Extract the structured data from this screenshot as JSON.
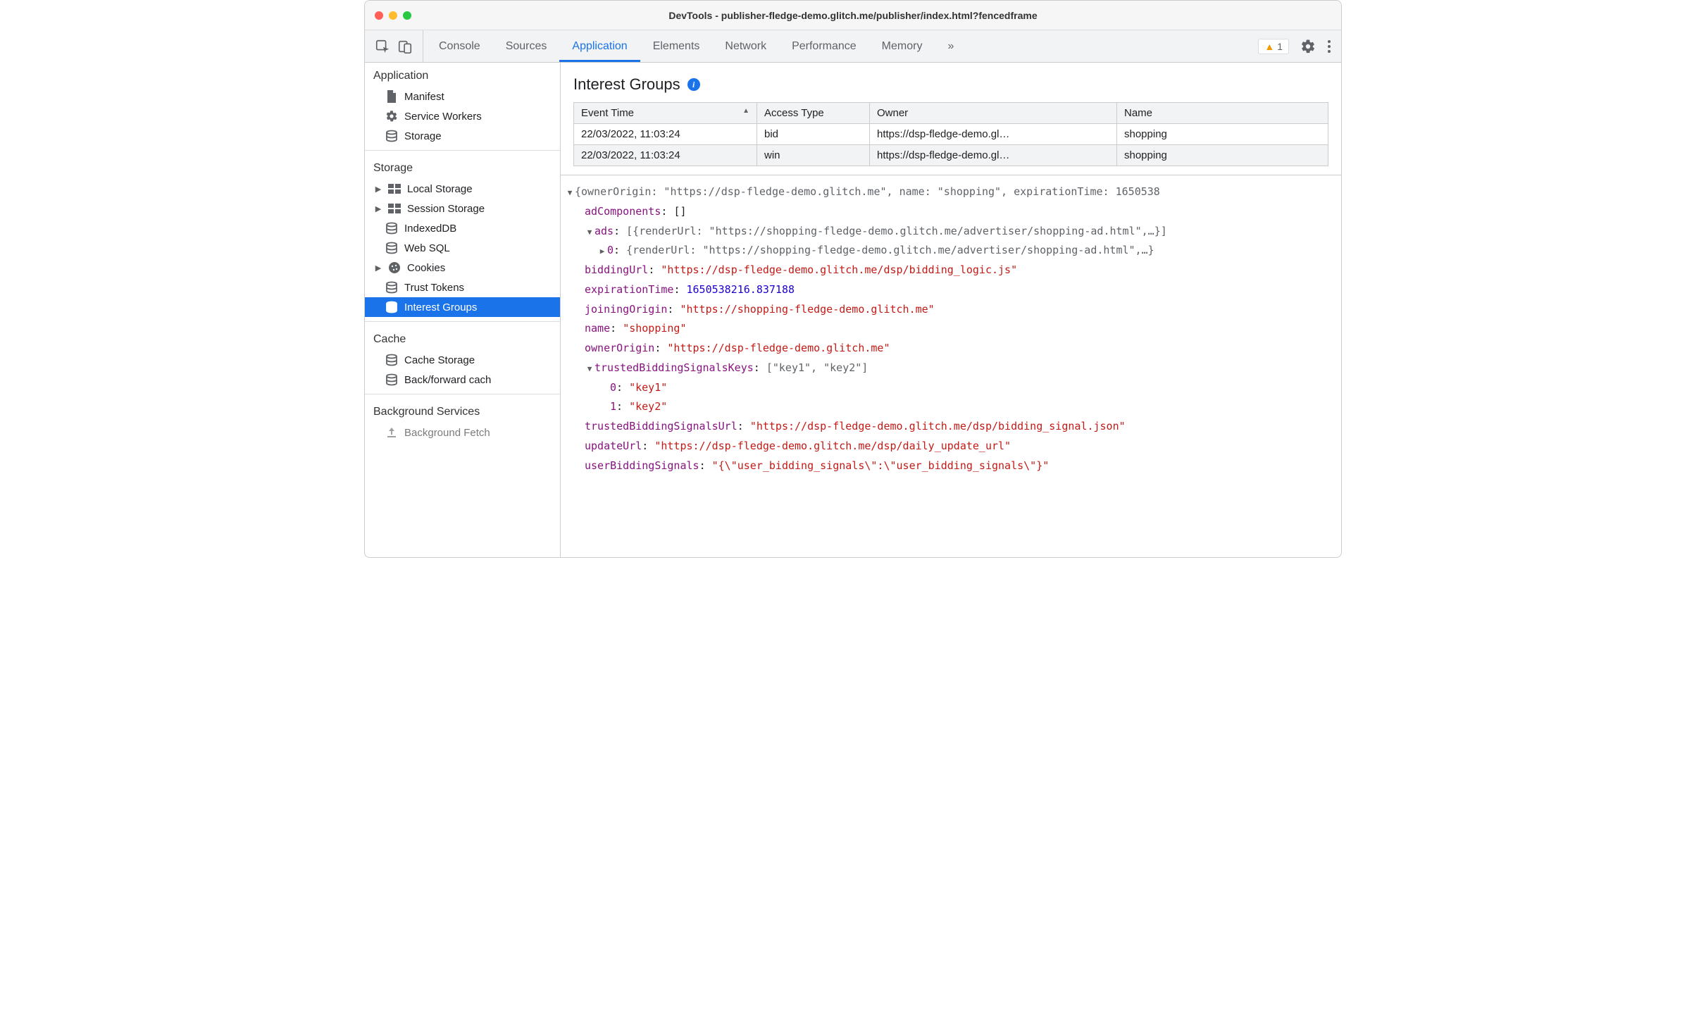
{
  "window": {
    "title": "DevTools - publisher-fledge-demo.glitch.me/publisher/index.html?fencedframe"
  },
  "toolbar": {
    "tabs": [
      "Console",
      "Sources",
      "Application",
      "Elements",
      "Network",
      "Performance",
      "Memory"
    ],
    "active_tab_index": 2,
    "more_label": "»",
    "warning_count": "1"
  },
  "sidebar": {
    "section_application": "Application",
    "app_items": [
      "Manifest",
      "Service Workers",
      "Storage"
    ],
    "section_storage": "Storage",
    "storage_items": [
      "Local Storage",
      "Session Storage",
      "IndexedDB",
      "Web SQL",
      "Cookies",
      "Trust Tokens",
      "Interest Groups"
    ],
    "section_cache": "Cache",
    "cache_items": [
      "Cache Storage",
      "Back/forward cach"
    ],
    "section_bg": "Background Services",
    "bg_items": [
      "Background Fetch"
    ]
  },
  "panel": {
    "title": "Interest Groups"
  },
  "table": {
    "columns": [
      "Event Time",
      "Access Type",
      "Owner",
      "Name"
    ],
    "sorted_col": 0,
    "rows": [
      {
        "time": "22/03/2022, 11:03:24",
        "type": "bid",
        "owner": "https://dsp-fledge-demo.gl…",
        "name": "shopping"
      },
      {
        "time": "22/03/2022, 11:03:24",
        "type": "win",
        "owner": "https://dsp-fledge-demo.gl…",
        "name": "shopping"
      }
    ]
  },
  "detail": {
    "header_preview": "{ownerOrigin: \"https://dsp-fledge-demo.glitch.me\", name: \"shopping\", expirationTime: 1650538",
    "adComponents_key": "adComponents",
    "adComponents_val": "[]",
    "ads_key": "ads",
    "ads_preview": "[{renderUrl: \"https://shopping-fledge-demo.glitch.me/advertiser/shopping-ad.html\",…}]",
    "ads0_key": "0",
    "ads0_preview": "{renderUrl: \"https://shopping-fledge-demo.glitch.me/advertiser/shopping-ad.html\",…}",
    "biddingUrl_key": "biddingUrl",
    "biddingUrl_val": "\"https://dsp-fledge-demo.glitch.me/dsp/bidding_logic.js\"",
    "expirationTime_key": "expirationTime",
    "expirationTime_val": "1650538216.837188",
    "joiningOrigin_key": "joiningOrigin",
    "joiningOrigin_val": "\"https://shopping-fledge-demo.glitch.me\"",
    "name_key": "name",
    "name_val": "\"shopping\"",
    "ownerOrigin_key": "ownerOrigin",
    "ownerOrigin_val": "\"https://dsp-fledge-demo.glitch.me\"",
    "tbsk_key": "trustedBiddingSignalsKeys",
    "tbsk_preview": "[\"key1\", \"key2\"]",
    "tbsk0_key": "0",
    "tbsk0_val": "\"key1\"",
    "tbsk1_key": "1",
    "tbsk1_val": "\"key2\"",
    "tbsu_key": "trustedBiddingSignalsUrl",
    "tbsu_val": "\"https://dsp-fledge-demo.glitch.me/dsp/bidding_signal.json\"",
    "updateUrl_key": "updateUrl",
    "updateUrl_val": "\"https://dsp-fledge-demo.glitch.me/dsp/daily_update_url\"",
    "userBiddingSignals_key": "userBiddingSignals",
    "userBiddingSignals_val": "\"{\\\"user_bidding_signals\\\":\\\"user_bidding_signals\\\"}\""
  }
}
